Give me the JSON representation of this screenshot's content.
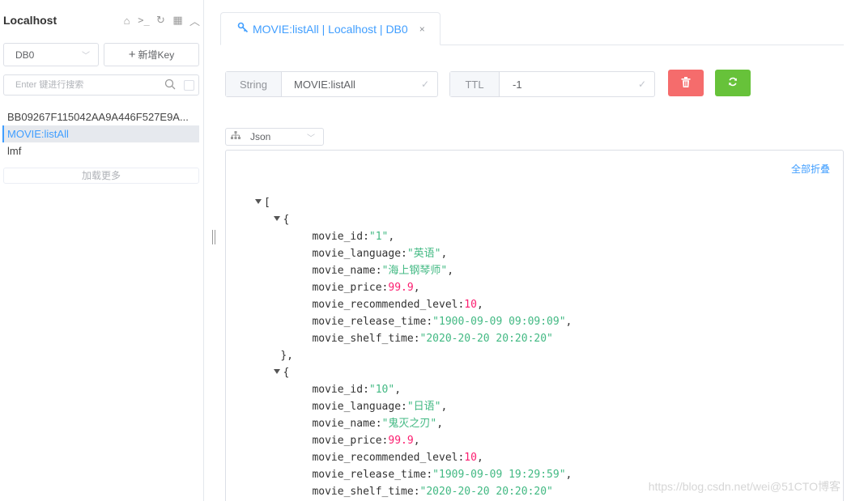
{
  "sidebar": {
    "title": "Localhost",
    "icons": [
      "home-icon",
      "terminal-icon",
      "refresh-icon",
      "grid-icon",
      "chevron-up-icon"
    ],
    "db_select": "DB0",
    "add_key_label": "新增Key",
    "search_placeholder": "Enter 键进行搜索",
    "keys": [
      {
        "label": "BB09267F115042AA9A446F527E9A..."
      },
      {
        "label": "MOVIE:listAll"
      },
      {
        "label": "lmf"
      }
    ],
    "load_more": "加载更多"
  },
  "tab": {
    "label": "MOVIE:listAll | Localhost | DB0",
    "close": "×"
  },
  "toolbar": {
    "type_label": "String",
    "key_name": "MOVIE:listAll",
    "ttl_label": "TTL",
    "ttl_value": "-1",
    "delete_color": "#f56c6c",
    "refresh_color": "#67c23a"
  },
  "viewer": {
    "format": "Json",
    "collapse_all": "全部折叠"
  },
  "json": {
    "open_bracket": "[",
    "open_brace": "{",
    "close_brace": "},",
    "items": [
      {
        "movie_id": "\"1\"",
        "movie_language": "\"英语\"",
        "movie_name": "\"海上钢琴师\"",
        "movie_price": "99.9",
        "movie_recommended_level": "10",
        "movie_release_time": "\"1900-09-09 09:09:09\"",
        "movie_shelf_time": "\"2020-20-20 20:20:20\""
      },
      {
        "movie_id": "\"10\"",
        "movie_language": "\"日语\"",
        "movie_name": "\"鬼灭之刃\"",
        "movie_price": "99.9",
        "movie_recommended_level": "10",
        "movie_release_time": "\"1909-09-09 19:29:59\"",
        "movie_shelf_time": "\"2020-20-20 20:20:20\""
      }
    ],
    "keys": {
      "id": "movie_id",
      "language": "movie_language",
      "name": "movie_name",
      "price": "movie_price",
      "level": "movie_recommended_level",
      "release": "movie_release_time",
      "shelf": "movie_shelf_time"
    },
    "colon": ":",
    "comma": ","
  },
  "watermark": "https://blog.csdn.net/wei@51CTO博客"
}
